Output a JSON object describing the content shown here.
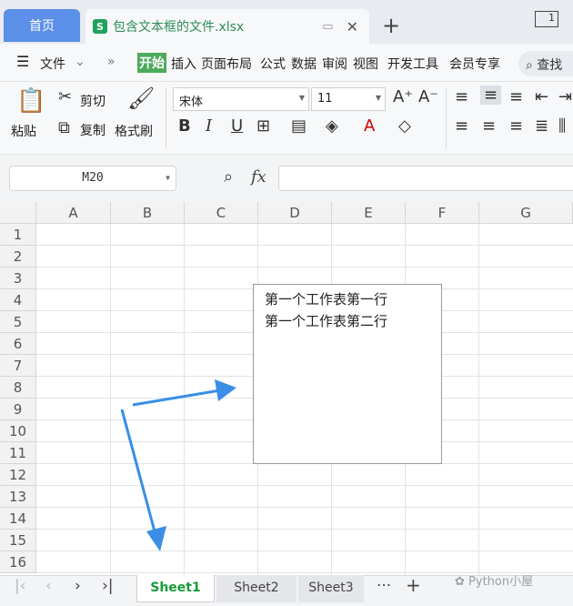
{
  "titlebar": {
    "home_tab": "首页",
    "file_tab": "包含文本框的文件.xlsx",
    "file_icon": "S",
    "new_tab": "+",
    "window_badge": "1"
  },
  "menubar": {
    "file_menu": "文件",
    "items": [
      "开始",
      "插入",
      "页面布局",
      "公式",
      "数据",
      "审阅",
      "视图",
      "开发工具",
      "会员专享"
    ],
    "search": "查找"
  },
  "ribbon": {
    "paste": "粘贴",
    "cut": "剪切",
    "copy": "复制",
    "format_painter": "格式刷",
    "font_name": "宋体",
    "font_size": "11",
    "bold": "B",
    "italic": "I",
    "underline": "U"
  },
  "formula": {
    "name_box": "M20",
    "fx": "fx",
    "value": ""
  },
  "grid": {
    "columns": [
      "A",
      "B",
      "C",
      "D",
      "E",
      "F",
      "G"
    ],
    "rows": [
      "1",
      "2",
      "3",
      "4",
      "5",
      "6",
      "7",
      "8",
      "9",
      "10",
      "11",
      "12",
      "13",
      "14",
      "15",
      "16"
    ]
  },
  "textbox": {
    "line1": "第一个工作表第一行",
    "line2": "第一个工作表第二行"
  },
  "sheets": {
    "tabs": [
      "Sheet1",
      "Sheet2",
      "Sheet3"
    ],
    "active": "Sheet1",
    "more": "···",
    "add": "+"
  },
  "watermark": "Python小屋",
  "colors": {
    "accent_green": "#4caa5d",
    "home_tab_blue": "#5b8fe8",
    "arrow_blue": "#3a8ee6"
  }
}
